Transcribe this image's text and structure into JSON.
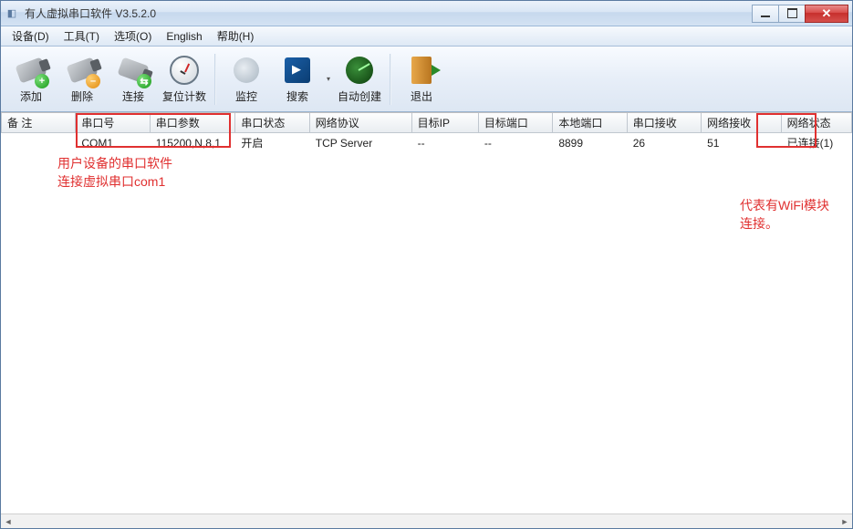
{
  "window": {
    "title": "有人虚拟串口软件 V3.5.2.0"
  },
  "menubar": {
    "items": [
      {
        "label": "设备(D)"
      },
      {
        "label": "工具(T)"
      },
      {
        "label": "选项(O)"
      },
      {
        "label": "English"
      },
      {
        "label": "帮助(H)"
      }
    ]
  },
  "toolbar": {
    "groups": [
      [
        {
          "label": "添加",
          "icon": "plug-add"
        },
        {
          "label": "删除",
          "icon": "plug-remove"
        },
        {
          "label": "连接",
          "icon": "connect"
        },
        {
          "label": "复位计数",
          "icon": "reset-counter"
        }
      ],
      [
        {
          "label": "监控",
          "icon": "monitor"
        },
        {
          "label": "搜索",
          "icon": "search",
          "has_dropdown": true
        },
        {
          "label": "自动创建",
          "icon": "auto-create"
        }
      ],
      [
        {
          "label": "退出",
          "icon": "exit"
        }
      ]
    ]
  },
  "table": {
    "columns": [
      "备 注",
      "串口号",
      "串口参数",
      "串口状态",
      "网络协议",
      "目标IP",
      "目标端口",
      "本地端口",
      "串口接收",
      "网络接收",
      "网络状态"
    ],
    "rows": [
      {
        "remark": "",
        "port": "COM1",
        "params": "115200,N,8,1",
        "port_state": "开启",
        "protocol": "TCP Server",
        "target_ip": "--",
        "target_port": "--",
        "local_port": "8899",
        "serial_rx": "26",
        "net_rx": "51",
        "net_state": "已连接(1)"
      }
    ]
  },
  "annotations": {
    "left_text_line1": "用户设备的串口软件",
    "left_text_line2": "连接虚拟串口com1",
    "right_text_line1": "代表有WiFi模块",
    "right_text_line2": "连接。"
  }
}
